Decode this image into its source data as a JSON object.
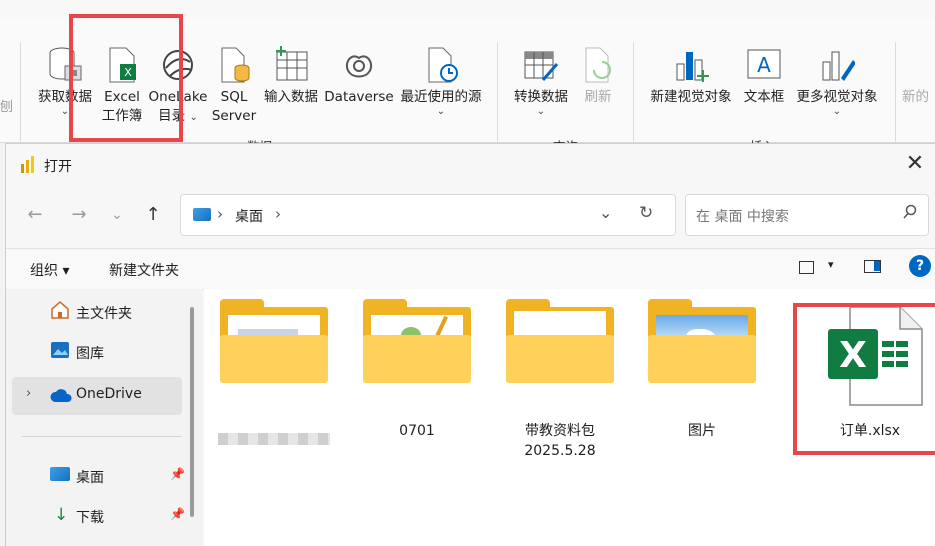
{
  "ribbon": {
    "items": [
      {
        "label1": "获取数据",
        "label2": "",
        "icon": "database-icon",
        "chevron": true
      },
      {
        "label1": "Excel",
        "label2": "工作簿",
        "icon": "excel-workbook-icon",
        "chevron": false
      },
      {
        "label1": "OneLake",
        "label2": "目录",
        "icon": "onelake-icon",
        "chevron": true
      },
      {
        "label1": "SQL",
        "label2": "Server",
        "icon": "sql-server-icon",
        "chevron": false
      },
      {
        "label1": "输入数据",
        "label2": "",
        "icon": "table-grid-icon",
        "chevron": false
      },
      {
        "label1": "Dataverse",
        "label2": "",
        "icon": "dataverse-icon",
        "chevron": false
      },
      {
        "label1": "最近使用的源",
        "label2": "",
        "icon": "recent-source-icon",
        "chevron": true
      },
      {
        "label1": "转换数据",
        "label2": "",
        "icon": "transform-table-icon",
        "chevron": true
      },
      {
        "label1": "刷新",
        "label2": "",
        "icon": "refresh-icon",
        "chevron": false
      },
      {
        "label1": "新建视觉对象",
        "label2": "",
        "icon": "new-visual-icon",
        "chevron": false
      },
      {
        "label1": "文本框",
        "label2": "",
        "icon": "textbox-icon",
        "chevron": false
      },
      {
        "label1": "更多视觉对象",
        "label2": "",
        "icon": "more-visuals-icon",
        "chevron": true
      },
      {
        "label1": "新的",
        "label2": "",
        "icon": "",
        "chevron": false
      }
    ],
    "left_cut_label": "刨",
    "groups": {
      "data": "数据",
      "query": "查询",
      "insert": "插入"
    }
  },
  "dialog": {
    "title": "打开",
    "close": "✕",
    "address": {
      "path": "桌面",
      "sep": "›"
    },
    "search_placeholder": "在 桌面 中搜索",
    "toolbar": {
      "organize": "组织 ▾",
      "new_folder": "新建文件夹",
      "help": "?"
    },
    "sidebar": [
      {
        "label": "主文件夹",
        "icon": "home-icon"
      },
      {
        "label": "图库",
        "icon": "gallery-icon"
      },
      {
        "label": "OneDrive",
        "icon": "cloud-icon"
      },
      {
        "label": "桌面",
        "icon": "desktop-icon"
      },
      {
        "label": "下载",
        "icon": "download-icon"
      }
    ],
    "files": [
      {
        "name": "",
        "name2": "",
        "type": "folder-blurred"
      },
      {
        "name": "0701",
        "name2": "",
        "type": "folder"
      },
      {
        "name": "带教资料包",
        "name2": "2025.5.28",
        "type": "folder"
      },
      {
        "name": "图片",
        "name2": "",
        "type": "folder"
      },
      {
        "name": "订单.xlsx",
        "name2": "",
        "type": "excel"
      }
    ]
  },
  "colors": {
    "accent": "#0067c0",
    "highlight": "#e8474a",
    "folder": "#f0b323",
    "excel": "#107c41"
  }
}
